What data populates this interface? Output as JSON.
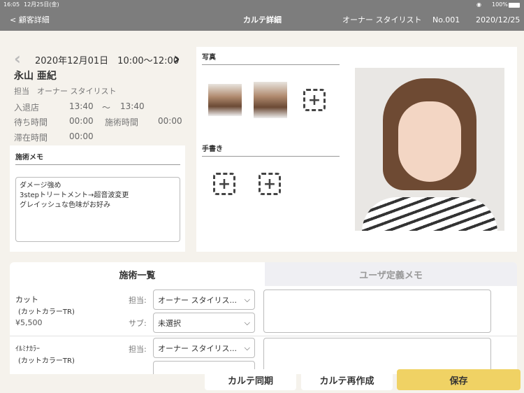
{
  "status": {
    "time": "16:05",
    "date": "12月25日(金)",
    "battery": "100%"
  },
  "nav": {
    "back": "< 顧客詳細",
    "title": "カルテ詳細",
    "staff": "オーナー スタイリスト",
    "number": "No.001",
    "date": "2020/12/25"
  },
  "visit": {
    "datetime": "2020年12月01日　10:00〜12:00",
    "customer": "永山 亜紀",
    "staff_label": "担当",
    "staff": "オーナー スタイリスト",
    "in_out_label": "入退店",
    "in": "13:40",
    "tilde": "〜",
    "out": "13:40",
    "wait_label": "待ち時間",
    "wait": "00:00",
    "treat_label": "施術時間",
    "treat": "00:00",
    "stay_label": "滞在時間",
    "stay": "00:00"
  },
  "memo": {
    "title": "施術メモ",
    "lines": [
      "ダメージ強め",
      "3stepトリートメント→超音波変更",
      "グレイッシュな色味がお好み"
    ]
  },
  "photos": {
    "title": "写真",
    "handwriting": "手書き"
  },
  "tabs": {
    "active": "施術一覧",
    "inactive": "ユーザ定義メモ"
  },
  "services": [
    {
      "name": "カット",
      "category": "(カットカラーTR)",
      "price": "¥5,500",
      "staff_label": "担当:",
      "staff": "オーナー スタイリス...",
      "sub_label": "サブ:",
      "sub": "未選択"
    },
    {
      "name": "ｲﾙﾐﾅｶﾗｰ",
      "category": "(カットカラーTR)",
      "staff_label": "担当:",
      "staff": "オーナー スタイリス..."
    }
  ],
  "buttons": {
    "sync": "カルテ同期",
    "recreate": "カルテ再作成",
    "save": "保存"
  },
  "colors": {
    "bar": "#7d7d7d",
    "bg": "#f5f2ec",
    "save": "#f0d264"
  }
}
